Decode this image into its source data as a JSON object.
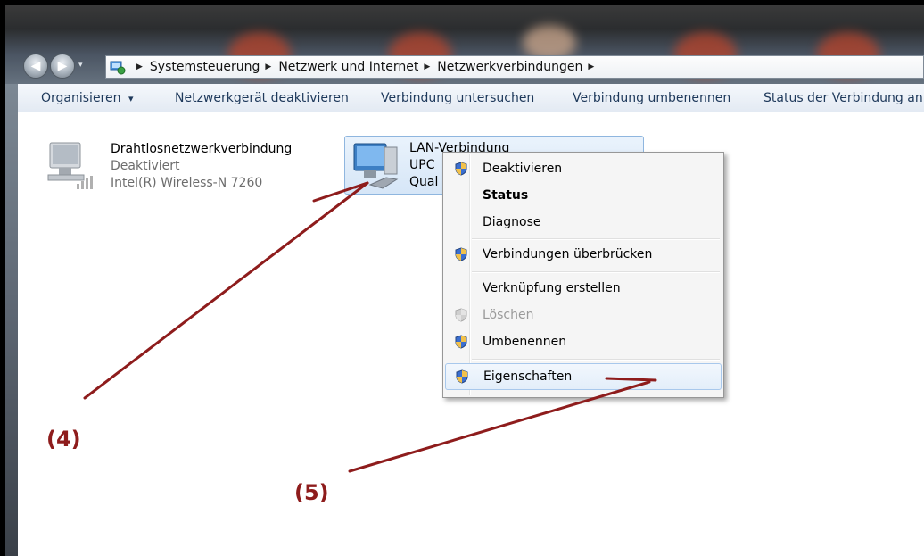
{
  "address_bar": {
    "breadcrumbs": [
      "Systemsteuerung",
      "Netzwerk und Internet",
      "Netzwerkverbindungen"
    ]
  },
  "toolbar": {
    "organize": "Organisieren",
    "organize_arrow": "▾",
    "disable_device": "Netzwerkgerät deaktivieren",
    "diagnose": "Verbindung untersuchen",
    "rename": "Verbindung umbenennen",
    "status": "Status der Verbindung an"
  },
  "connections": [
    {
      "name": "Drahtlosnetzwerkverbindung",
      "status": "Deaktiviert",
      "device": "Intel(R) Wireless-N 7260"
    },
    {
      "name": "LAN-Verbindung",
      "status": "UPC",
      "device": "Qual"
    }
  ],
  "context_menu": {
    "items": [
      {
        "label": "Deaktivieren",
        "icon": "uac-shield-icon"
      },
      {
        "label": "Status"
      },
      {
        "label": "Diagnose"
      },
      {
        "label": "Verbindungen überbrücken",
        "icon": "uac-shield-icon"
      },
      {
        "label": "Verknüpfung erstellen"
      },
      {
        "label": "Löschen",
        "icon": "uac-shield-icon"
      },
      {
        "label": "Umbenennen",
        "icon": "uac-shield-icon"
      },
      {
        "label": "Eigenschaften",
        "icon": "uac-shield-icon"
      }
    ]
  },
  "annotations": {
    "label_4": "(4)",
    "label_5": "(5)",
    "color": "#8e1c1c"
  },
  "colors": {
    "toolbar_text": "#1e395b",
    "selection_border": "#8fb6df"
  }
}
